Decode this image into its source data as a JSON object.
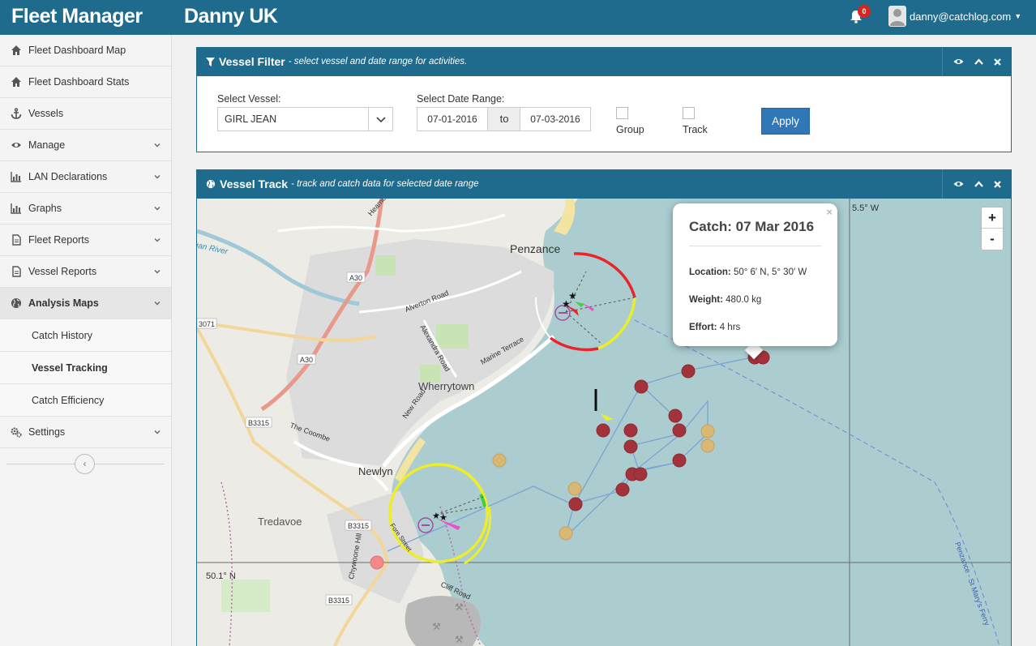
{
  "app": {
    "title": "Fleet Manager",
    "company": "Danny UK"
  },
  "header": {
    "notification_count": "0",
    "user_email": "danny@catchlog.com"
  },
  "sidebar": {
    "items": [
      {
        "label": "Fleet Dashboard Map",
        "icon": "home-icon"
      },
      {
        "label": "Fleet Dashboard Stats",
        "icon": "home-icon"
      },
      {
        "label": "Vessels",
        "icon": "anchor-icon"
      },
      {
        "label": "Manage",
        "icon": "eye-icon"
      },
      {
        "label": "LAN Declarations",
        "icon": "bar-chart-icon"
      },
      {
        "label": "Graphs",
        "icon": "bar-chart-icon"
      },
      {
        "label": "Fleet Reports",
        "icon": "document-icon"
      },
      {
        "label": "Vessel Reports",
        "icon": "document-icon"
      },
      {
        "label": "Analysis Maps",
        "icon": "globe-icon"
      },
      {
        "label": "Settings",
        "icon": "cogs-icon"
      }
    ],
    "sub_items": [
      {
        "label": "Catch History"
      },
      {
        "label": "Vessel Tracking"
      },
      {
        "label": "Catch Efficiency"
      }
    ]
  },
  "filter_panel": {
    "title": "Vessel Filter",
    "subtitle": "- select vessel and date range for activities.",
    "vessel_label": "Select Vessel:",
    "vessel_value": "GIRL JEAN",
    "date_label": "Select Date Range:",
    "date_from": "07-01-2016",
    "date_to_label": "to",
    "date_to": "07-03-2016",
    "group_label": "Group",
    "track_label": "Track",
    "apply_label": "Apply"
  },
  "track_panel": {
    "title": "Vessel Track",
    "subtitle": "- track and catch data for selected date range"
  },
  "map": {
    "labels": {
      "penzance": "Penzance",
      "wherrytown": "Wherrytown",
      "newlyn": "Newlyn",
      "tredavoe": "Tredavoe",
      "alverton_road": "Alverton Road",
      "alexandra_road": "Alexandra Road",
      "marine_terrace": "Marine Terrace",
      "new_road": "New Road",
      "the_coombe": "The Coombe",
      "chywoone_hill": "Chywoone Hill",
      "cliff_road": "Cliff Road",
      "fore_street": "Fore Street",
      "a30_north": "A30",
      "a30_south": "A30",
      "b3315_1": "B3315",
      "b3315_2": "B3315",
      "b3315_3": "B3315",
      "r3071": "3071",
      "river": "Poggan River",
      "heamoor": "Heamoor",
      "ferry": "Penzance - St Mary's Ferry",
      "lon_label": "5.5° W",
      "lat_label": "50.1° N"
    },
    "zoom_in": "+",
    "zoom_out": "-",
    "popup": {
      "title": "Catch: 07 Mar 2016",
      "close": "×",
      "location_label": "Location:",
      "location_value": "50° 6′ N, 5° 30′ W",
      "weight_label": "Weight:",
      "weight_value": "480.0 kg",
      "effort_label": "Effort:",
      "effort_value": "4 hrs"
    }
  },
  "colors": {
    "header": "#1f6b8d",
    "sea": "#abcdd0",
    "catch_marker": "#a2333b",
    "catch_marker_faded": "#d9b775",
    "track_line": "#7aa3d6",
    "apply": "#2f77b6"
  }
}
